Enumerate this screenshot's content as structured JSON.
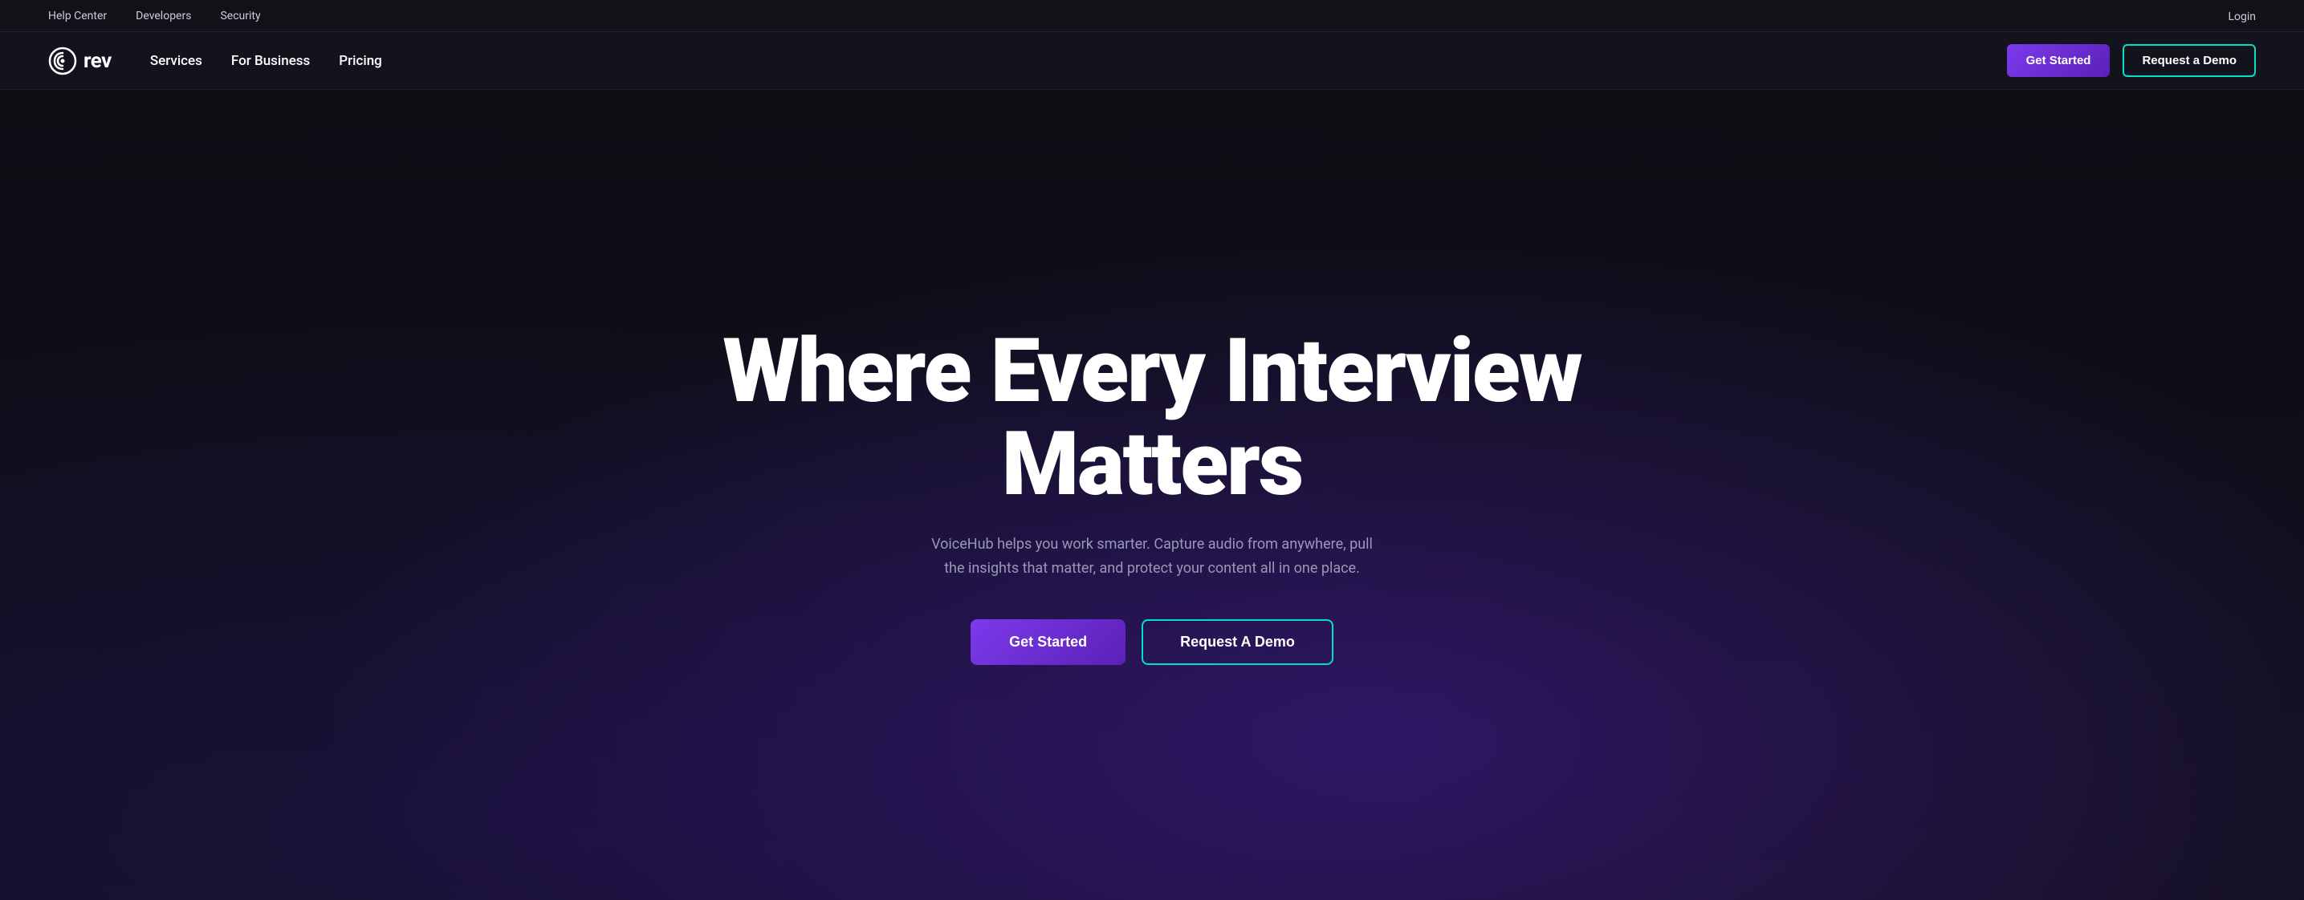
{
  "topBar": {
    "links": [
      {
        "id": "help-center",
        "label": "Help Center"
      },
      {
        "id": "developers",
        "label": "Developers"
      },
      {
        "id": "security",
        "label": "Security"
      }
    ],
    "login": "Login"
  },
  "mainNav": {
    "logo": {
      "icon_name": "rev-logo-icon",
      "text": "rev"
    },
    "links": [
      {
        "id": "services",
        "label": "Services"
      },
      {
        "id": "for-business",
        "label": "For Business"
      },
      {
        "id": "pricing",
        "label": "Pricing"
      }
    ],
    "cta": {
      "get_started": "Get Started",
      "request_demo": "Request a Demo"
    }
  },
  "hero": {
    "title": "Where Every Interview Matters",
    "subtitle": "VoiceHub helps you work smarter. Capture audio from anywhere, pull the insights that matter, and protect your content all in one place.",
    "get_started": "Get Started",
    "request_demo": "Request A Demo"
  }
}
